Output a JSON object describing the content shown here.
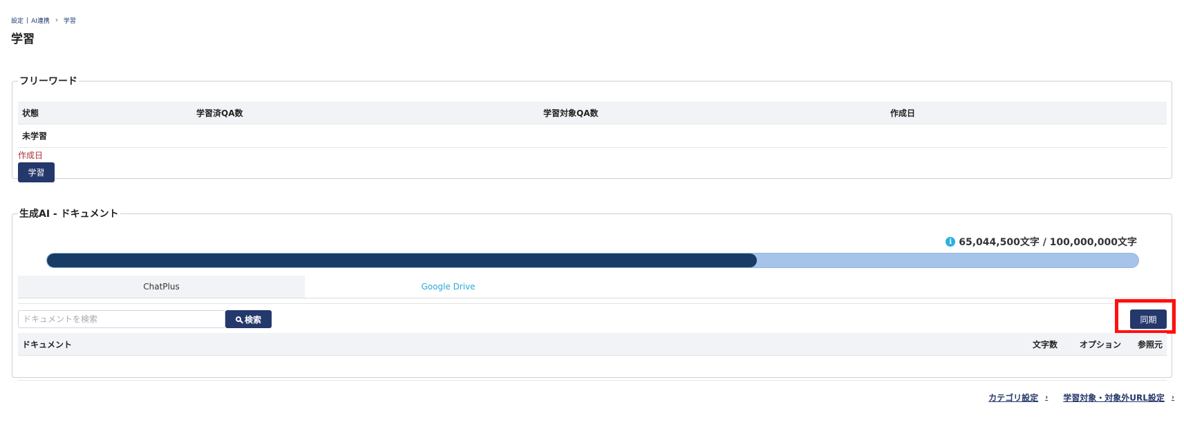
{
  "breadcrumb": {
    "settings": "設定",
    "divider": "|",
    "ai_link": "AI連携",
    "current": "学習"
  },
  "page": {
    "title": "学習"
  },
  "freeword": {
    "legend": "フリーワード",
    "columns": [
      "状態",
      "学習済QA数",
      "学習対象QA数",
      "作成日"
    ],
    "row": {
      "status": "未学習",
      "learned_qa": "",
      "target_qa": "",
      "created": ""
    },
    "error_text": "作成日",
    "learn_button": "学習"
  },
  "genai": {
    "legend": "生成AI - ドキュメント",
    "quota_text": "65,044,500文字 / 100,000,000文字",
    "quota_used": 65044500,
    "quota_total": 100000000,
    "tabs": [
      {
        "label": "ChatPlus",
        "active": true
      },
      {
        "label": "Google Drive",
        "active": false
      }
    ],
    "search": {
      "placeholder": "ドキュメントを検索",
      "value": "",
      "button": "検索"
    },
    "sync_button": "同期",
    "table": {
      "columns": {
        "document": "ドキュメント",
        "chars": "文字数",
        "options": "オプション",
        "source": "参照元"
      }
    }
  },
  "footer": {
    "category_link": "カテゴリ設定",
    "url_link": "学習対象・対象外URL設定"
  },
  "colors": {
    "navy": "#24386b",
    "progress_fill": "#173d67",
    "progress_track": "#a6c4ea",
    "highlight": "#ff1010",
    "tab_link": "#2aa8d8"
  },
  "icons": [
    "chevron-right-icon",
    "info-icon",
    "search-icon"
  ]
}
